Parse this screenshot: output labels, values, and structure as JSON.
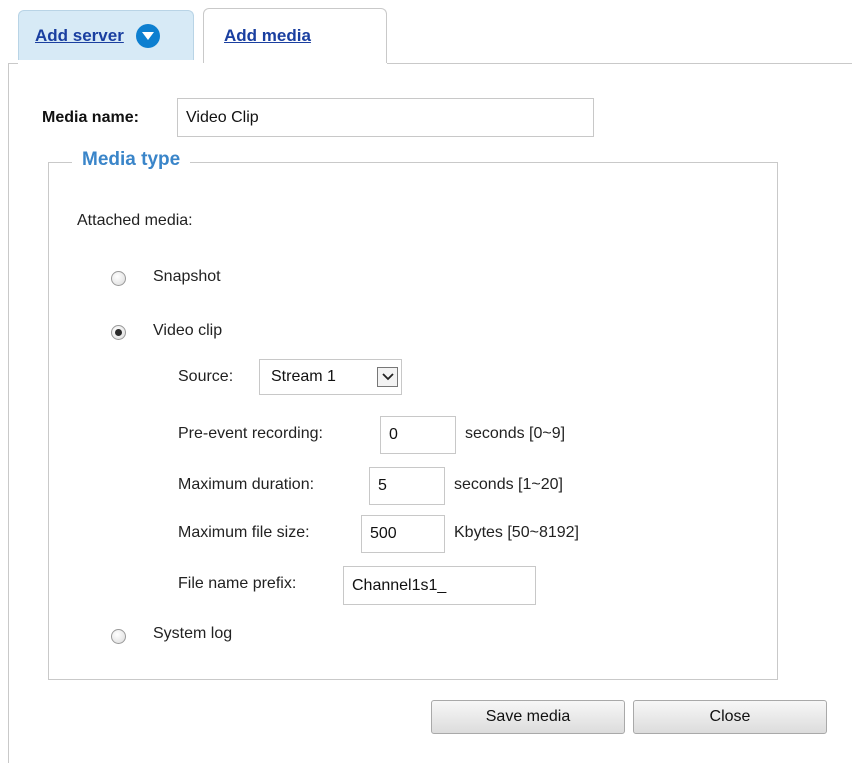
{
  "tabs": {
    "add_server": "Add server",
    "add_media": "Add media"
  },
  "media_name": {
    "label": "Media name:",
    "value": "Video Clip"
  },
  "media_type": {
    "legend": "Media type",
    "attached_label": "Attached media:",
    "options": {
      "snapshot": "Snapshot",
      "video_clip": "Video clip",
      "system_log": "System log"
    },
    "selected": "video_clip"
  },
  "video_clip": {
    "source_label": "Source:",
    "source_value": "Stream 1",
    "pre_event_label": "Pre-event recording:",
    "pre_event_value": "0",
    "pre_event_unit": "seconds [0~9]",
    "max_duration_label": "Maximum duration:",
    "max_duration_value": "5",
    "max_duration_unit": "seconds [1~20]",
    "max_file_size_label": "Maximum file size:",
    "max_file_size_value": "500",
    "max_file_size_unit": "Kbytes [50~8192]",
    "prefix_label": "File name prefix:",
    "prefix_value": "Channel1s1_"
  },
  "buttons": {
    "save": "Save media",
    "close": "Close"
  },
  "colors": {
    "link": "#1a3fa0",
    "legend": "#3a85c9",
    "tab_active_bg": "#d7eaf6",
    "chevron_circle": "#0d7fd0"
  }
}
